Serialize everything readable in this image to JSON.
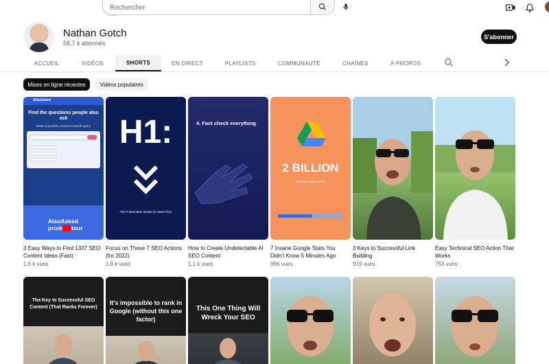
{
  "search": {
    "placeholder": "Rechercher"
  },
  "channel": {
    "name": "Nathan Gotch",
    "subscribers": "58,7 k abonnés",
    "subscribe_label": "S'abonner"
  },
  "tabs": [
    {
      "label": "ACCUEIL"
    },
    {
      "label": "VIDÉOS"
    },
    {
      "label": "SHORTS"
    },
    {
      "label": "EN DIRECT"
    },
    {
      "label": "PLAYLISTS"
    },
    {
      "label": "COMMUNAUTÉ"
    },
    {
      "label": "CHAÎNES"
    },
    {
      "label": "À PROPOS"
    }
  ],
  "active_tab": "SHORTS",
  "chips": {
    "recent": "Mises en ligne récentes",
    "popular": "Vidéos populaires"
  },
  "shorts": [
    {
      "title": "3 Easy Ways to Find 1337 SEO Content Ideas (Fast)",
      "views": "1,6 k vues",
      "thumb": {
        "brand": "AlsoAsked",
        "headline": "Find the questions people also ask",
        "subline": "Enter a question, brand or search query",
        "promo": "AlsoAsked product tour"
      }
    },
    {
      "title": "Focus on These 7 SEO Actions (for 2022)",
      "views": "1,8 k vues",
      "thumb": {
        "headline": "H1:",
        "caption": "<h1>7 Best Blue Shoes for 2022</h1>"
      }
    },
    {
      "title": "How to Create Undetectable AI SEO Content",
      "views": "1,1 k vues",
      "thumb": {
        "caption": "4. Fact check everything"
      }
    },
    {
      "title": "7 Insane Google Stats You Didn't Know 5 Minutes Ago",
      "views": "956 vues",
      "thumb": {
        "big": "2 BILLION",
        "caption": "Monthly Active Users"
      }
    },
    {
      "title": "3 Keys to Successful Link Building",
      "views": "919 vues"
    },
    {
      "title": "Easy Technical SEO Action That Works",
      "views": "753 vues"
    }
  ],
  "shorts_row2": [
    {
      "caption": "The Key to Successful SEO Content (That Ranks Forever)"
    },
    {
      "caption": "It's impossible to rank in Google (without this one factor)"
    },
    {
      "caption": "This One Thing Will Wreck Your SEO"
    },
    {
      "caption": ""
    },
    {
      "caption": ""
    },
    {
      "caption": ""
    }
  ],
  "colors": {
    "accent": "#0f0f0f",
    "chip_bg": "#f2f2f2",
    "thumb4_bg": "#f6935d"
  }
}
